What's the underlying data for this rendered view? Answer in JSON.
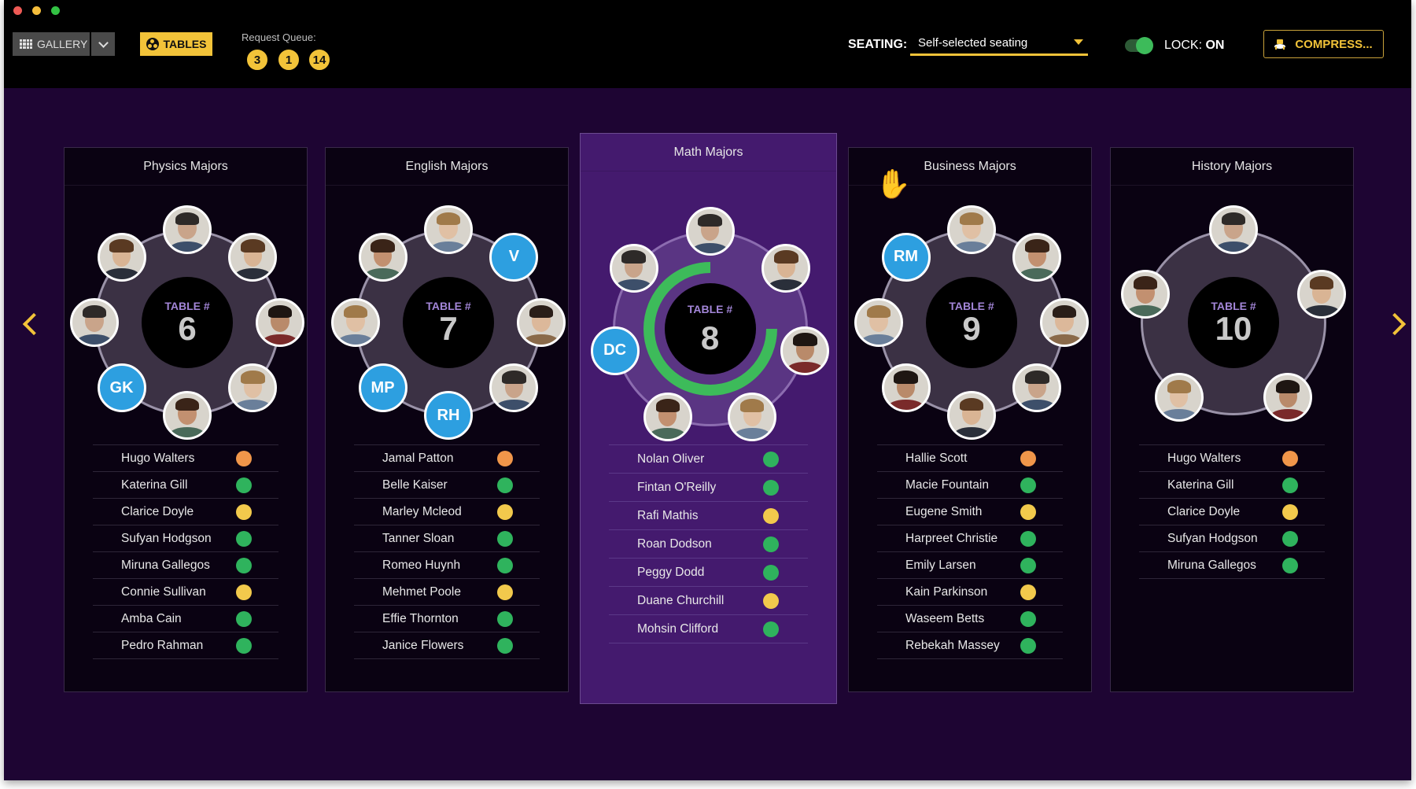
{
  "toolbar": {
    "gallery_label": "GALLERY",
    "tables_label": "TABLES",
    "request_queue_label": "Request Queue:",
    "request_queue": [
      "3",
      "1",
      "14"
    ],
    "seating_label": "SEATING:",
    "seating_value": "Self-selected seating",
    "lock_label": "LOCK:",
    "lock_value": "ON",
    "lock_on": true,
    "compress_label": "COMPRESS..."
  },
  "colors": {
    "accent": "#f2c339",
    "initials_bg": "#2d9fe0",
    "status_orange": "#f0964a",
    "status_green": "#2fb35d",
    "status_yellow": "#f2c94c",
    "progress_green": "#3dbb5a"
  },
  "tables": [
    {
      "title": "Physics Majors",
      "table_label": "TABLE #",
      "number": "6",
      "selected": false,
      "raised_hand": false,
      "seats": [
        {
          "type": "photo"
        },
        {
          "type": "photo"
        },
        {
          "type": "photo"
        },
        {
          "type": "photo"
        },
        {
          "type": "photo"
        },
        {
          "type": "initials",
          "text": "GK"
        },
        {
          "type": "photo"
        },
        {
          "type": "photo"
        }
      ],
      "members": [
        {
          "name": "Hugo Walters",
          "status": "orange"
        },
        {
          "name": "Katerina Gill",
          "status": "green"
        },
        {
          "name": "Clarice Doyle",
          "status": "yellow"
        },
        {
          "name": "Sufyan Hodgson",
          "status": "green"
        },
        {
          "name": "Miruna Gallegos",
          "status": "green"
        },
        {
          "name": "Connie Sullivan",
          "status": "yellow"
        },
        {
          "name": "Amba Cain",
          "status": "green"
        },
        {
          "name": "Pedro Rahman",
          "status": "green"
        }
      ]
    },
    {
      "title": "English Majors",
      "table_label": "TABLE #",
      "number": "7",
      "selected": false,
      "raised_hand": false,
      "seats": [
        {
          "type": "photo"
        },
        {
          "type": "initials",
          "text": "V"
        },
        {
          "type": "photo"
        },
        {
          "type": "photo"
        },
        {
          "type": "initials",
          "text": "RH"
        },
        {
          "type": "initials",
          "text": "MP"
        },
        {
          "type": "photo"
        },
        {
          "type": "photo"
        }
      ],
      "members": [
        {
          "name": "Jamal Patton",
          "status": "orange"
        },
        {
          "name": "Belle Kaiser",
          "status": "green"
        },
        {
          "name": "Marley Mcleod",
          "status": "yellow"
        },
        {
          "name": "Tanner Sloan",
          "status": "green"
        },
        {
          "name": "Romeo Huynh",
          "status": "green"
        },
        {
          "name": "Mehmet Poole",
          "status": "yellow"
        },
        {
          "name": "Effie Thornton",
          "status": "green"
        },
        {
          "name": "Janice Flowers",
          "status": "green"
        }
      ]
    },
    {
      "title": "Math Majors",
      "table_label": "TABLE #",
      "number": "8",
      "selected": true,
      "raised_hand": false,
      "progress": 0.75,
      "seats": [
        {
          "type": "photo"
        },
        {
          "type": "photo"
        },
        {
          "type": "photo"
        },
        {
          "type": "photo"
        },
        {
          "type": "photo"
        },
        {
          "type": "initials",
          "text": "DC"
        },
        {
          "type": "photo"
        }
      ],
      "members": [
        {
          "name": "Nolan Oliver",
          "status": "green"
        },
        {
          "name": "Fintan O'Reilly",
          "status": "green"
        },
        {
          "name": "Rafi Mathis",
          "status": "yellow"
        },
        {
          "name": "Roan Dodson",
          "status": "green"
        },
        {
          "name": "Peggy Dodd",
          "status": "green"
        },
        {
          "name": "Duane Churchill",
          "status": "yellow"
        },
        {
          "name": "Mohsin Clifford",
          "status": "green"
        }
      ]
    },
    {
      "title": "Business Majors",
      "table_label": "TABLE #",
      "number": "9",
      "selected": false,
      "raised_hand": true,
      "seats": [
        {
          "type": "photo"
        },
        {
          "type": "photo"
        },
        {
          "type": "photo"
        },
        {
          "type": "photo"
        },
        {
          "type": "photo"
        },
        {
          "type": "photo"
        },
        {
          "type": "photo"
        },
        {
          "type": "initials",
          "text": "RM"
        }
      ],
      "members": [
        {
          "name": "Hallie Scott",
          "status": "orange"
        },
        {
          "name": "Macie Fountain",
          "status": "green"
        },
        {
          "name": "Eugene Smith",
          "status": "yellow"
        },
        {
          "name": "Harpreet Christie",
          "status": "green"
        },
        {
          "name": "Emily Larsen",
          "status": "green"
        },
        {
          "name": "Kain Parkinson",
          "status": "yellow"
        },
        {
          "name": "Waseem Betts",
          "status": "green"
        },
        {
          "name": "Rebekah Massey",
          "status": "green"
        }
      ]
    },
    {
      "title": "History Majors",
      "table_label": "TABLE #",
      "number": "10",
      "selected": false,
      "raised_hand": false,
      "seats": [
        {
          "type": "photo"
        },
        {
          "type": "photo"
        },
        {
          "type": "photo"
        },
        {
          "type": "photo"
        },
        {
          "type": "photo"
        }
      ],
      "members": [
        {
          "name": "Hugo Walters",
          "status": "orange"
        },
        {
          "name": "Katerina Gill",
          "status": "green"
        },
        {
          "name": "Clarice Doyle",
          "status": "yellow"
        },
        {
          "name": "Sufyan Hodgson",
          "status": "green"
        },
        {
          "name": "Miruna Gallegos",
          "status": "green"
        }
      ]
    }
  ]
}
